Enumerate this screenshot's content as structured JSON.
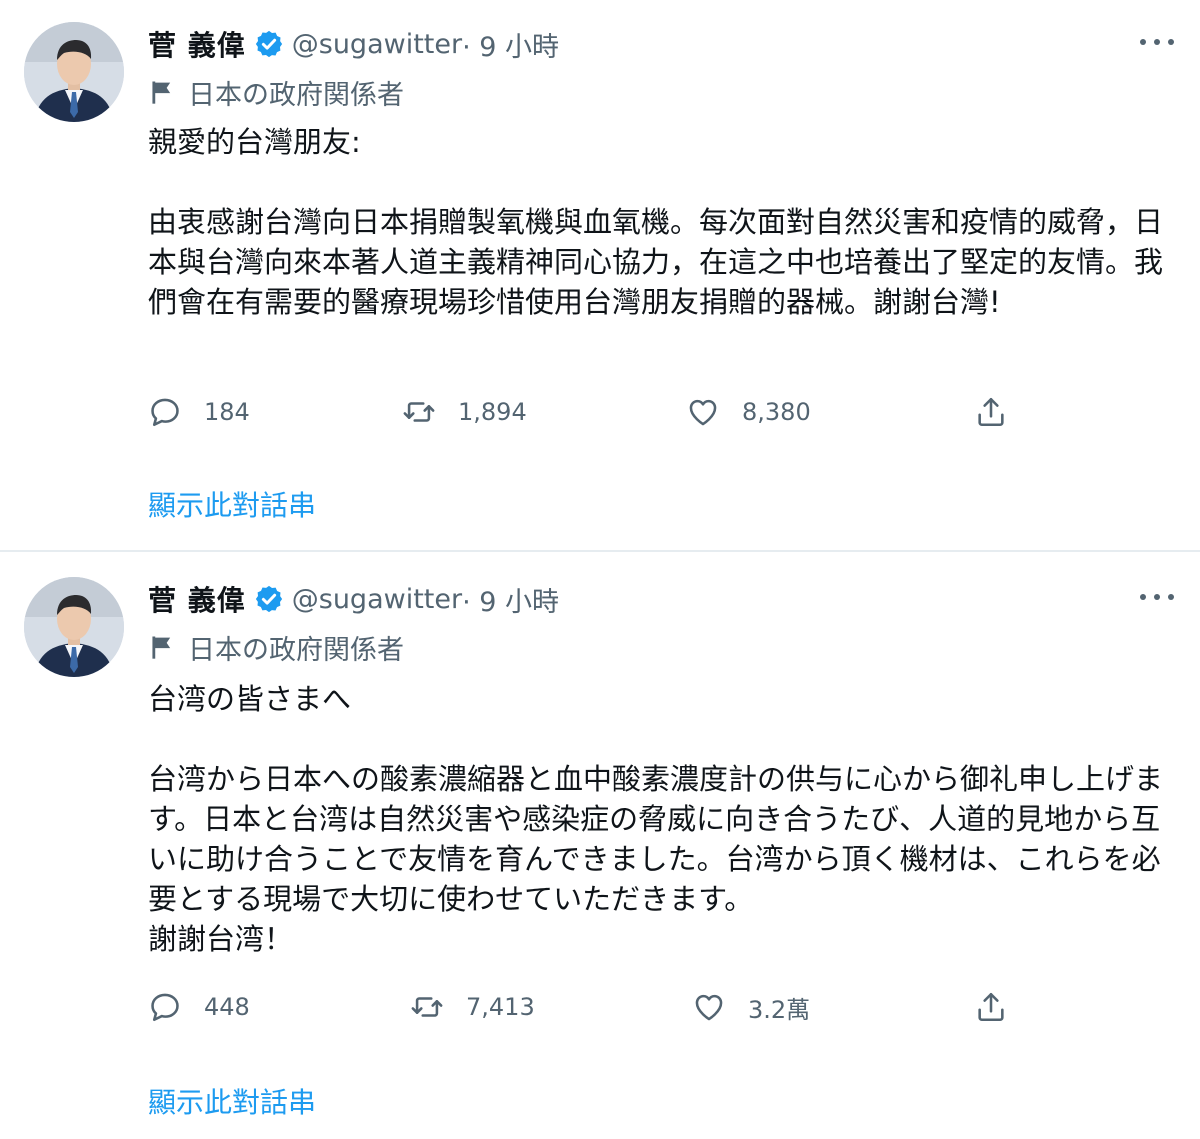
{
  "colors": {
    "accent": "#1d9bf0",
    "muted": "#536471",
    "text": "#0f1419",
    "divider": "#e6ecf0"
  },
  "tweets": [
    {
      "author": {
        "name": "菅 義偉",
        "handle": "@sugawitter",
        "time": " · 9 小時",
        "verified": true
      },
      "label": "日本の政府関係者",
      "text": "親愛的台灣朋友:\n\n由衷感謝台灣向日本捐贈製氧機與血氧機。每次面對自然災害和疫情的威脅，日本與台灣向來本著人道主義精神同心協力，在這之中也培養出了堅定的友情。我們會在有需要的醫療現場珍惜使用台灣朋友捐贈的器械。謝謝台灣!",
      "stats": {
        "replies": "184",
        "retweets": "1,894",
        "likes": "8,380"
      },
      "thread_link": "顯示此對話串"
    },
    {
      "author": {
        "name": "菅 義偉",
        "handle": "@sugawitter",
        "time": " · 9 小時",
        "verified": true
      },
      "label": "日本の政府関係者",
      "text": "台湾の皆さまへ\n\n台湾から日本への酸素濃縮器と血中酸素濃度計の供与に心から御礼申し上げます。日本と台湾は自然災害や感染症の脅威に向き合うたび、人道的見地から互いに助け合うことで友情を育んできました。台湾から頂く機材は、これらを必要とする現場で大切に使わせていただきます。\n謝謝台湾！",
      "stats": {
        "replies": "448",
        "retweets": "7,413",
        "likes": "3.2萬"
      },
      "thread_link": "顯示此對話串"
    }
  ],
  "icons": {
    "avatar": "avatar-photo",
    "verified": "verified-badge-icon",
    "more": "more-options-icon",
    "label": "flag-icon",
    "reply": "reply-icon",
    "retweet": "retweet-icon",
    "like": "heart-icon",
    "share": "share-icon"
  }
}
